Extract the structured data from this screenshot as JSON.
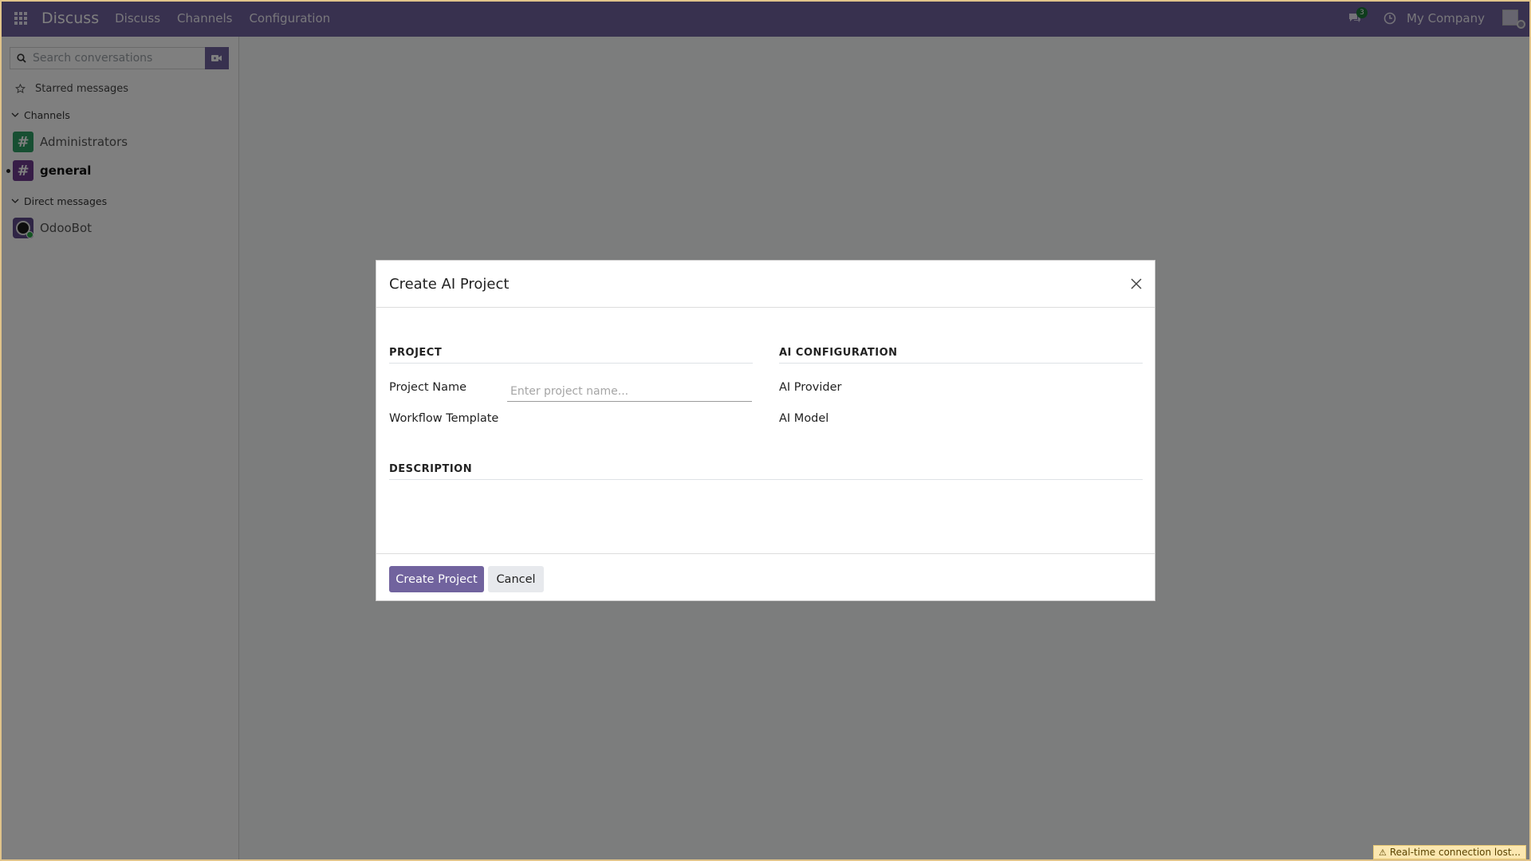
{
  "navbar": {
    "app_name": "Discuss",
    "menu": [
      "Discuss",
      "Channels",
      "Configuration"
    ],
    "chat_badge_count": "3",
    "company": "My Company",
    "brand_color": "#71639e"
  },
  "sidebar": {
    "search_placeholder": "Search conversations",
    "starred_label": "Starred messages",
    "channels_header": "Channels",
    "channels": [
      {
        "name": "Administrators",
        "color": "#2e9f64"
      },
      {
        "name": "general",
        "color": "#6e3a8f",
        "active": true
      }
    ],
    "dm_header": "Direct messages",
    "direct_messages": [
      {
        "name": "OdooBot",
        "status": "online"
      }
    ]
  },
  "modal": {
    "title": "Create AI Project",
    "sections": {
      "project": "PROJECT",
      "ai_config": "AI CONFIGURATION",
      "description": "DESCRIPTION"
    },
    "fields": {
      "project_name_label": "Project Name",
      "project_name_placeholder": "Enter project name...",
      "project_name_value": "",
      "workflow_template_label": "Workflow Template",
      "ai_provider_label": "AI Provider",
      "ai_model_label": "AI Model"
    },
    "buttons": {
      "create": "Create Project",
      "cancel": "Cancel"
    }
  },
  "status": {
    "connection_message": "Real-time connection lost..."
  }
}
